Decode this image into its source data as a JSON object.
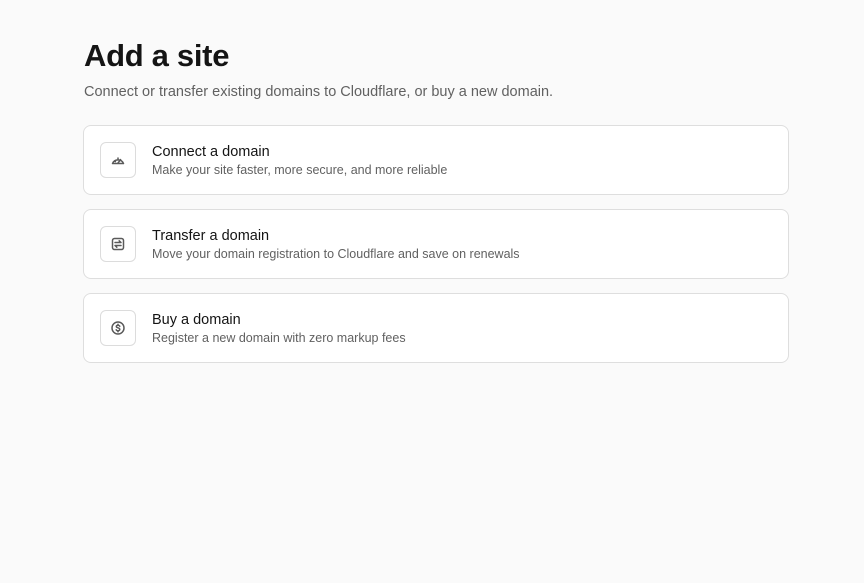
{
  "header": {
    "title": "Add a site",
    "subtitle": "Connect or transfer existing domains to Cloudflare, or buy a new domain."
  },
  "options": [
    {
      "icon": "speedometer-icon",
      "title": "Connect a domain",
      "description": "Make your site faster, more secure, and more reliable"
    },
    {
      "icon": "transfer-arrows-icon",
      "title": "Transfer a domain",
      "description": "Move your domain registration to Cloudflare and save on renewals"
    },
    {
      "icon": "dollar-coin-icon",
      "title": "Buy a domain",
      "description": "Register a new domain with zero markup fees"
    }
  ]
}
